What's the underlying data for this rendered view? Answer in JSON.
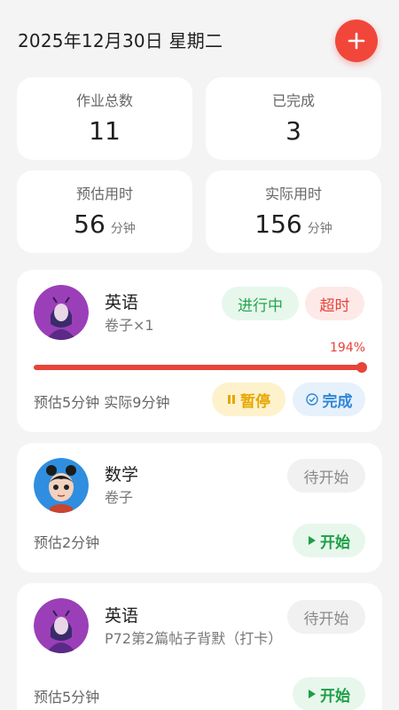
{
  "header": {
    "date": "2025年12月30日 星期二",
    "add_icon": "plus-icon"
  },
  "stats": [
    {
      "label": "作业总数",
      "value": "11",
      "unit": ""
    },
    {
      "label": "已完成",
      "value": "3",
      "unit": ""
    },
    {
      "label": "预估用时",
      "value": "56",
      "unit": "分钟"
    },
    {
      "label": "实际用时",
      "value": "156",
      "unit": "分钟"
    }
  ],
  "tasks": [
    {
      "subject": "英语",
      "desc": "卷子×1",
      "status": "进行中",
      "flag": "超时",
      "progress_label": "194%",
      "progress": 1.0,
      "time": "预估5分钟 实际9分钟",
      "pause_label": "暂停",
      "done_label": "完成"
    },
    {
      "subject": "数学",
      "desc": "卷子",
      "status": "待开始",
      "time": "预估2分钟",
      "start_label": "开始"
    },
    {
      "subject": "英语",
      "desc": "P72第2篇帖子背默（打卡）",
      "status": "待开始",
      "time": "预估5分钟",
      "start_label": "开始"
    }
  ],
  "colors": {
    "accent": "#f0473a",
    "green": "#24a64e",
    "yellow": "#e8a600",
    "blue": "#2e86d9"
  }
}
